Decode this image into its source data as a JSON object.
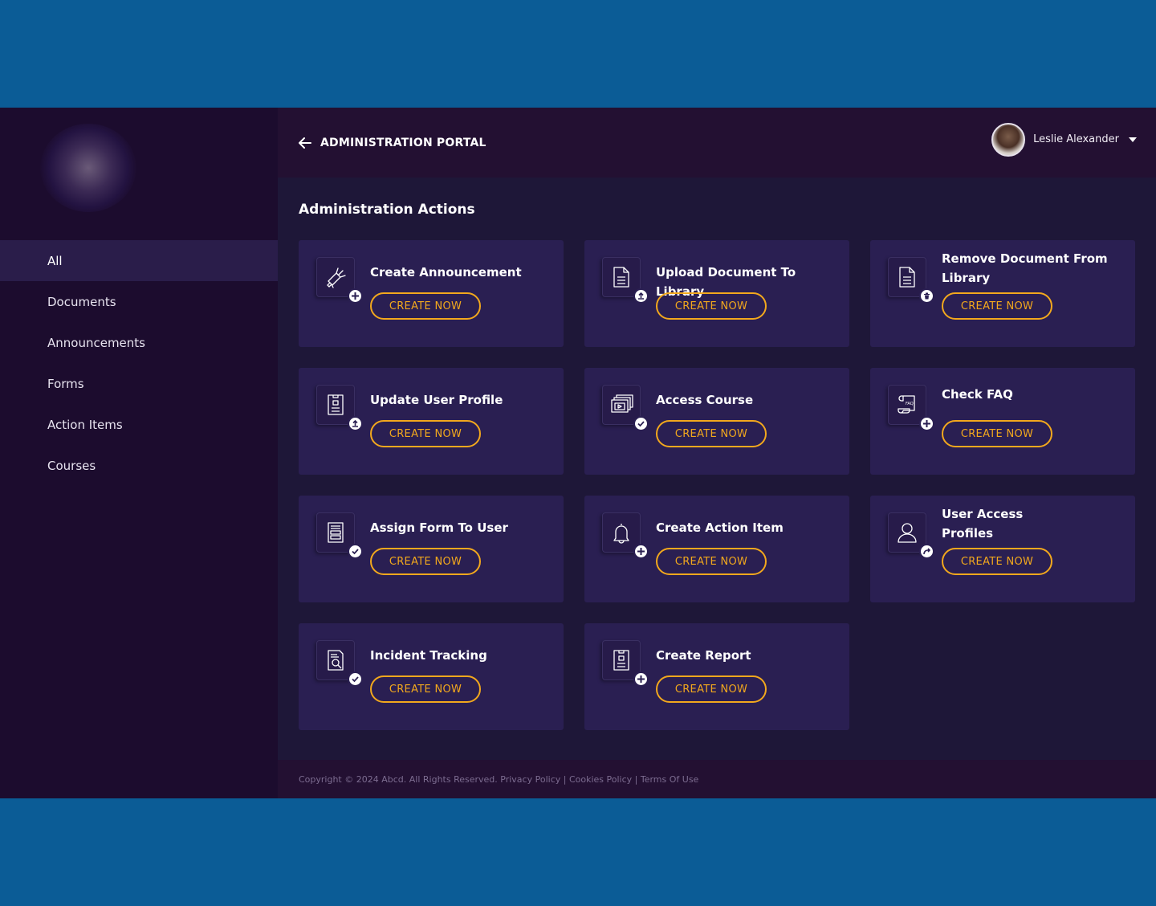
{
  "header": {
    "portal_title": "ADMINISTRATION PORTAL",
    "user_name": "Leslie Alexander"
  },
  "sidebar": {
    "items": [
      {
        "label": "All",
        "active": true
      },
      {
        "label": "Documents"
      },
      {
        "label": "Announcements"
      },
      {
        "label": "Forms"
      },
      {
        "label": "Action Items"
      },
      {
        "label": "Courses"
      }
    ]
  },
  "main": {
    "section_title": "Administration Actions",
    "cards": [
      {
        "title": "Create Announcement",
        "button": "CREATE NOW",
        "icon": "megaphone-icon",
        "badge": "plus-icon"
      },
      {
        "title": "Upload Document To Library",
        "button": "CREATE NOW",
        "icon": "document-icon",
        "badge": "upload-icon"
      },
      {
        "title": "Remove Document From Library",
        "button": "CREATE NOW",
        "icon": "document-icon",
        "badge": "trash-icon"
      },
      {
        "title": "Update User Profile",
        "button": "CREATE NOW",
        "icon": "profile-document-icon",
        "badge": "upload-icon"
      },
      {
        "title": "Access Course",
        "button": "CREATE NOW",
        "icon": "course-slides-icon",
        "badge": "check-icon"
      },
      {
        "title": "Check FAQ",
        "button": "CREATE NOW",
        "icon": "faq-scroll-icon",
        "badge": "plus-icon"
      },
      {
        "title": "Assign Form To User",
        "button": "CREATE NOW",
        "icon": "form-icon",
        "badge": "check-icon"
      },
      {
        "title": "Create Action Item",
        "button": "CREATE NOW",
        "icon": "bell-icon",
        "badge": "plus-icon"
      },
      {
        "title": "User Access Profiles",
        "button": "CREATE NOW",
        "icon": "user-icon",
        "badge": "share-icon"
      },
      {
        "title": "Incident Tracking",
        "button": "CREATE NOW",
        "icon": "incident-search-icon",
        "badge": "check-icon"
      },
      {
        "title": "Create Report",
        "button": "CREATE NOW",
        "icon": "report-icon",
        "badge": "plus-icon"
      }
    ]
  },
  "footer": {
    "text": "Copyright © 2024 Abcd. All Rights Reserved. Privacy Policy | Cookies Policy | Terms Of Use"
  },
  "colors": {
    "page_bg": "#0b5c96",
    "sidebar_bg": "#1c0c2e",
    "main_bg": "#1e1738",
    "card_bg": "#2a1f52",
    "accent": "#f2a81d"
  }
}
